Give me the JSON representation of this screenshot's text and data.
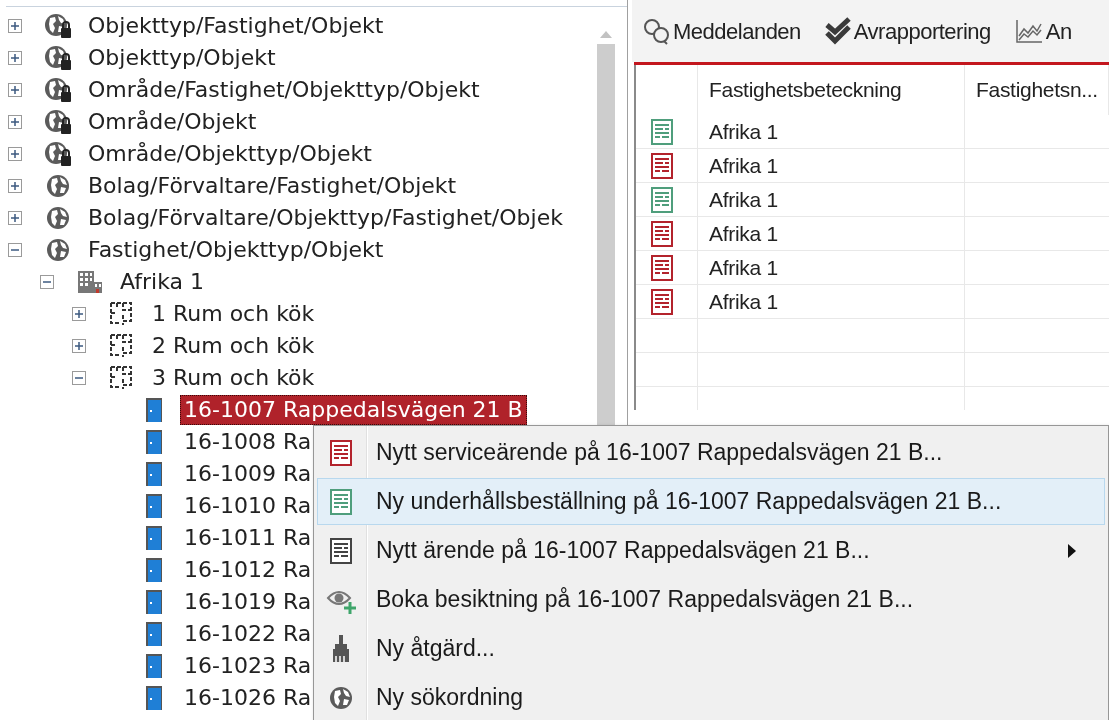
{
  "tree": [
    {
      "label": "Objekttyp/Fastighet/Objekt",
      "kind": "locked-globe",
      "expanded": false
    },
    {
      "label": "Objekttyp/Objekt",
      "kind": "locked-globe",
      "expanded": false
    },
    {
      "label": "Område/Fastighet/Objekttyp/Objekt",
      "kind": "locked-globe",
      "expanded": false
    },
    {
      "label": "Område/Objekt",
      "kind": "locked-globe",
      "expanded": false
    },
    {
      "label": "Område/Objekttyp/Objekt",
      "kind": "locked-globe",
      "expanded": false
    },
    {
      "label": "Bolag/Förvaltare/Fastighet/Objekt",
      "kind": "globe",
      "expanded": false
    },
    {
      "label": "Bolag/Förvaltare/Objekttyp/Fastighet/Objek",
      "kind": "globe",
      "expanded": false
    },
    {
      "label": "Fastighet/Objekttyp/Objekt",
      "kind": "globe",
      "expanded": true,
      "children": [
        {
          "label": "Afrika 1",
          "kind": "building",
          "expanded": true,
          "children": [
            {
              "label": "1 Rum och kök",
              "kind": "floorplan",
              "expanded": false
            },
            {
              "label": "2 Rum och kök",
              "kind": "floorplan",
              "expanded": false
            },
            {
              "label": "3 Rum och kök",
              "kind": "floorplan",
              "expanded": true,
              "children": [
                {
                  "label": "16-1007 Rappedalsvägen 21 B",
                  "kind": "door",
                  "selected": true
                },
                {
                  "label": "16-1008 Ra",
                  "kind": "door",
                  "selected": false
                },
                {
                  "label": "16-1009 Ra",
                  "kind": "door",
                  "selected": false
                },
                {
                  "label": "16-1010 Ra",
                  "kind": "door",
                  "selected": false
                },
                {
                  "label": "16-1011 Ra",
                  "kind": "door",
                  "selected": false
                },
                {
                  "label": "16-1012 Ra",
                  "kind": "door",
                  "selected": false
                },
                {
                  "label": "16-1019 Ra",
                  "kind": "door",
                  "selected": false
                },
                {
                  "label": "16-1022 Ra",
                  "kind": "door",
                  "selected": false
                },
                {
                  "label": "16-1023 Ra",
                  "kind": "door",
                  "selected": false
                },
                {
                  "label": "16-1026 Ra",
                  "kind": "door",
                  "selected": false
                }
              ]
            }
          ]
        }
      ]
    }
  ],
  "toolbar": [
    {
      "label": "Meddelanden",
      "kind": "chat"
    },
    {
      "label": "Avrapportering",
      "kind": "check"
    },
    {
      "label": "An",
      "kind": "chart"
    }
  ],
  "table": {
    "columns": [
      "Fastighetsbeteckning",
      "Fastighetsn..."
    ],
    "rows": [
      {
        "color": "#4f9e7c",
        "cells": [
          "Afrika 1"
        ]
      },
      {
        "color": "#b3232c",
        "cells": [
          "Afrika 1"
        ]
      },
      {
        "color": "#4f9e7c",
        "cells": [
          "Afrika 1"
        ]
      },
      {
        "color": "#b3232c",
        "cells": [
          "Afrika 1"
        ]
      },
      {
        "color": "#b3232c",
        "cells": [
          "Afrika 1"
        ]
      },
      {
        "color": "#b3232c",
        "cells": [
          "Afrika 1"
        ]
      }
    ]
  },
  "context_menu": [
    {
      "label": "Nytt serviceärende på 16-1007 Rappedalsvägen 21 B...",
      "kind": "form",
      "color": "#b3232c",
      "selected": false,
      "submenu": false
    },
    {
      "label": "Ny underhållsbeställning på 16-1007 Rappedalsvägen 21 B...",
      "kind": "form",
      "color": "#4f9e7c",
      "selected": true,
      "submenu": false
    },
    {
      "label": "Nytt ärende på 16-1007 Rappedalsvägen 21 B...",
      "kind": "form",
      "color": "#444444",
      "selected": false,
      "submenu": true
    },
    {
      "label": "Boka besiktning på 16-1007 Rappedalsvägen 21 B...",
      "kind": "eye-plus",
      "selected": false,
      "submenu": false
    },
    {
      "label": "Ny åtgärd...",
      "kind": "brush",
      "selected": false,
      "submenu": false
    },
    {
      "label": "Ny sökordning",
      "kind": "globe",
      "selected": false,
      "submenu": false
    }
  ]
}
